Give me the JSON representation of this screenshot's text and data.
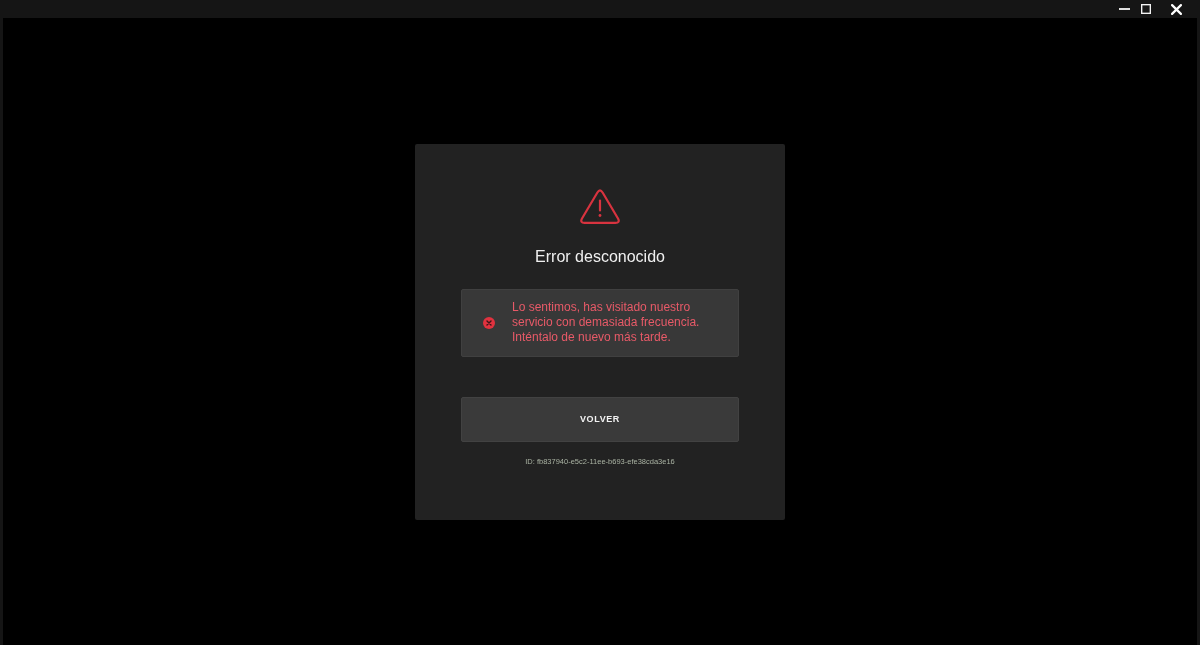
{
  "window": {
    "controls": [
      {
        "kind": "minimize"
      },
      {
        "kind": "maximize"
      },
      {
        "kind": "close"
      }
    ]
  },
  "dialog": {
    "title": "Error desconocido",
    "alert": {
      "message": "Lo sentimos, has visitado nuestro servicio con demasiada frecuencia. Inténtalo de nuevo más tarde."
    },
    "button": "VOLVER",
    "request_id": "ID: fb837940-e5c2-11ee-b693-efe38cda3e16"
  }
}
